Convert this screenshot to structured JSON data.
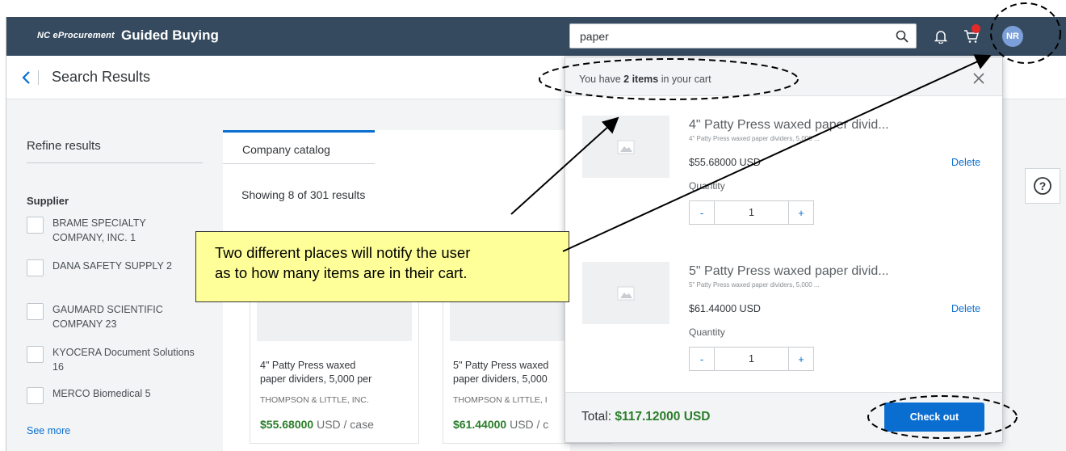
{
  "shell": {
    "brand_small": "NC eProcurement",
    "brand_title": "Guided Buying",
    "search_value": "paper",
    "avatar_initials": "NR"
  },
  "subheader": {
    "title": "Search Results"
  },
  "refine": {
    "heading": "Refine results",
    "supplier_title": "Supplier",
    "suppliers": [
      "BRAME SPECIALTY COMPANY, INC.  1",
      "DANA SAFETY SUPPLY  2",
      "GAUMARD SCIENTIFIC COMPANY  23",
      "KYOCERA Document Solutions  16",
      "MERCO Biomedical  5"
    ],
    "see_more": "See more"
  },
  "catalog": {
    "tab_label": "Company catalog",
    "results_count": "Showing 8 of 301 results",
    "cards": [
      {
        "name_line1": "4\" Patty Press waxed",
        "name_line2": "paper dividers, 5,000 per",
        "vendor": "THOMPSON & LITTLE, INC.",
        "price": "$55.68000",
        "unit": " USD / case"
      },
      {
        "name_line1": "5\" Patty Press waxed",
        "name_line2": "paper dividers, 5,000",
        "vendor": "THOMPSON & LITTLE, I",
        "price": "$61.44000",
        "unit": " USD / c"
      }
    ]
  },
  "cart": {
    "msg_prefix": "You have ",
    "msg_count": "2 items",
    "msg_suffix": " in your cart",
    "items": [
      {
        "name": "4\" Patty Press waxed paper divid...",
        "desc": "4\" Patty Press waxed paper dividers, 5,000 ...",
        "price": "$55.68000 USD",
        "delete": "Delete",
        "qty_label": "Quantity",
        "qty": "1"
      },
      {
        "name": "5\" Patty Press waxed paper divid...",
        "desc": "5\" Patty Press waxed paper dividers, 5,000 ...",
        "price": "$61.44000 USD",
        "delete": "Delete",
        "qty_label": "Quantity",
        "qty": "1"
      }
    ],
    "stepper_minus": "-",
    "stepper_plus": "+",
    "total_label": "Total: ",
    "total_value": "$117.12000 USD",
    "checkout": "Check out"
  },
  "callout": {
    "line1": "Two different places will notify the user",
    "line2": "as to how many items are in their cart."
  },
  "colors": {
    "shell_bg": "#354a5f",
    "accent_blue": "#0a6ed1",
    "price_green": "#2b7d2b",
    "callout_yellow": "#ffff99",
    "cart_badge_red": "#e52929"
  },
  "icons": [
    "back-chevron-icon",
    "search-icon",
    "bell-icon",
    "cart-icon",
    "close-icon",
    "image-placeholder-icon",
    "help-icon"
  ]
}
